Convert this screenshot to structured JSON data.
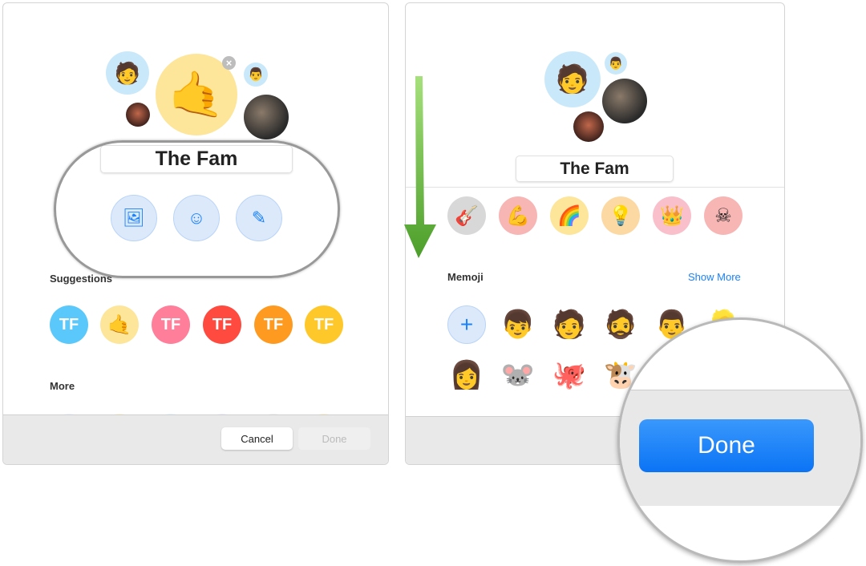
{
  "left_dialog": {
    "group_name": "The Fam",
    "action_buttons": [
      {
        "icon": "photos-icon",
        "glyph": "🖼"
      },
      {
        "icon": "emoji-icon",
        "glyph": "☺"
      },
      {
        "icon": "pencil-icon",
        "glyph": "✎"
      }
    ],
    "remove_glyph": "×",
    "selected_emoji": "🤙",
    "suggestions_label": "Suggestions",
    "suggestions": [
      {
        "text": "TF",
        "color": "#5ac8fa"
      },
      {
        "text": "🤙",
        "color": "#fde59a"
      },
      {
        "text": "TF",
        "color": "#ff7e9a"
      },
      {
        "text": "TF",
        "color": "#ff4a40"
      },
      {
        "text": "TF",
        "color": "#ff9a20"
      },
      {
        "text": "TF",
        "color": "#ffc82a"
      }
    ],
    "more_label": "More",
    "cancel_label": "Cancel",
    "done_label": "Done"
  },
  "right_dialog": {
    "group_name": "The Fam",
    "emoji_row": [
      {
        "glyph": "🎸",
        "color": "#d8d8d8"
      },
      {
        "glyph": "💪",
        "color": "#f7b6b4"
      },
      {
        "glyph": "🌈",
        "color": "#fde59a"
      },
      {
        "glyph": "💡",
        "color": "#fcd9a3"
      },
      {
        "glyph": "👑",
        "color": "#f9c0cb"
      },
      {
        "glyph": "☠",
        "color": "#f7b6b4"
      }
    ],
    "memoji_label": "Memoji",
    "show_more_label": "Show More",
    "add_glyph": "+",
    "memoji_row1": [
      "👦",
      "🧑",
      "🧔",
      "👨",
      "👱"
    ],
    "memoji_row2": [
      "👩",
      "🐭",
      "🐙",
      "🐮"
    ],
    "done_label": "Done"
  },
  "colors": {
    "accent": "#1a82fb",
    "arrow": "#6cc24a"
  }
}
